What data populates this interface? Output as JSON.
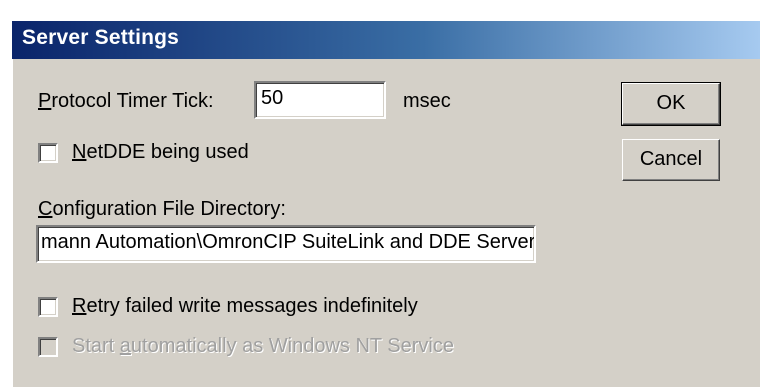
{
  "window": {
    "title": "Server Settings"
  },
  "protocol_timer": {
    "label_prefix": "",
    "label_accel": "P",
    "label_rest": "rotocol Timer Tick:",
    "value": "50",
    "unit": "msec"
  },
  "netdde": {
    "label_accel": "N",
    "label_rest": "etDDE being used",
    "checked": false
  },
  "config_dir": {
    "label_accel": "C",
    "label_rest": "onfiguration File Directory:",
    "value": "mann Automation\\OmronCIP SuiteLink and DDE Server\\"
  },
  "retry": {
    "label_accel": "R",
    "label_rest": "etry failed write messages indefinitely",
    "checked": false
  },
  "nt_service": {
    "label_before": "Start ",
    "label_accel": "a",
    "label_rest": "utomatically as Windows NT Service",
    "checked": false,
    "enabled": false
  },
  "buttons": {
    "ok": "OK",
    "cancel": "Cancel"
  }
}
